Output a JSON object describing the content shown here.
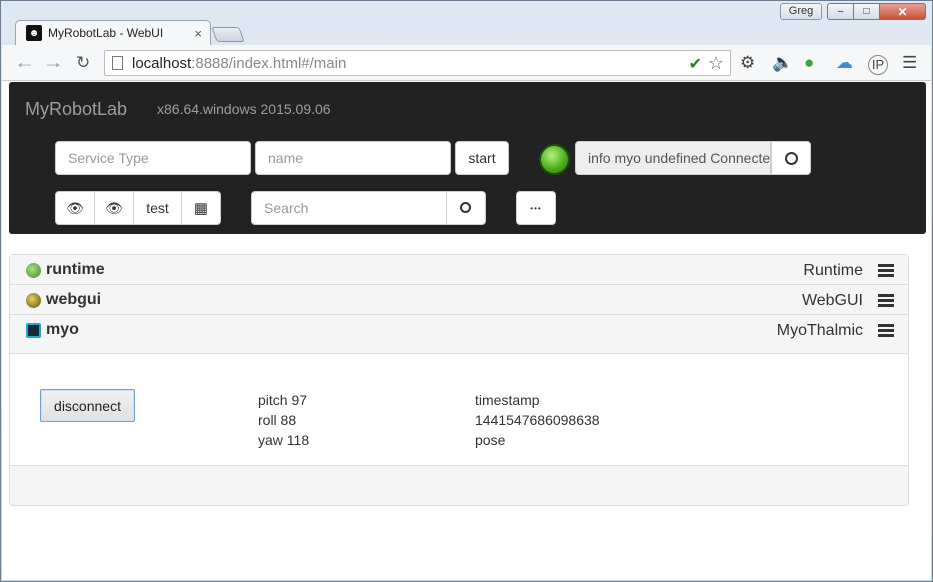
{
  "window": {
    "user": "Greg",
    "minimize_glyph": "–",
    "maximize_glyph": "□",
    "close_glyph": "✕"
  },
  "browser": {
    "tab_title": "MyRobotLab - WebUI",
    "tab_close": "×",
    "url_host": "localhost",
    "url_rest": ":8888/index.html#/main"
  },
  "navbar": {
    "brand": "MyRobotLab",
    "version": "x86.64.windows 2015.09.06",
    "service_type_placeholder": "Service Type",
    "name_placeholder": "name",
    "start_label": "start",
    "status_text": "info myo undefined Connected",
    "test_label": "test",
    "search_placeholder": "Search",
    "more_label": "•••"
  },
  "services": [
    {
      "name": "runtime",
      "type": "Runtime",
      "icon_color": "#5fa24a"
    },
    {
      "name": "webgui",
      "type": "WebGUI",
      "icon_color": "#7a6a1a"
    },
    {
      "name": "myo",
      "type": "MyoThalmic",
      "icon_color": "#2aa5c9"
    }
  ],
  "myo_panel": {
    "disconnect_label": "disconnect",
    "pitch": "pitch 97",
    "roll": "roll 88",
    "yaw": "yaw 118",
    "timestamp_label": "timestamp",
    "timestamp_value": "1441547686098638",
    "pose_label": "pose"
  }
}
